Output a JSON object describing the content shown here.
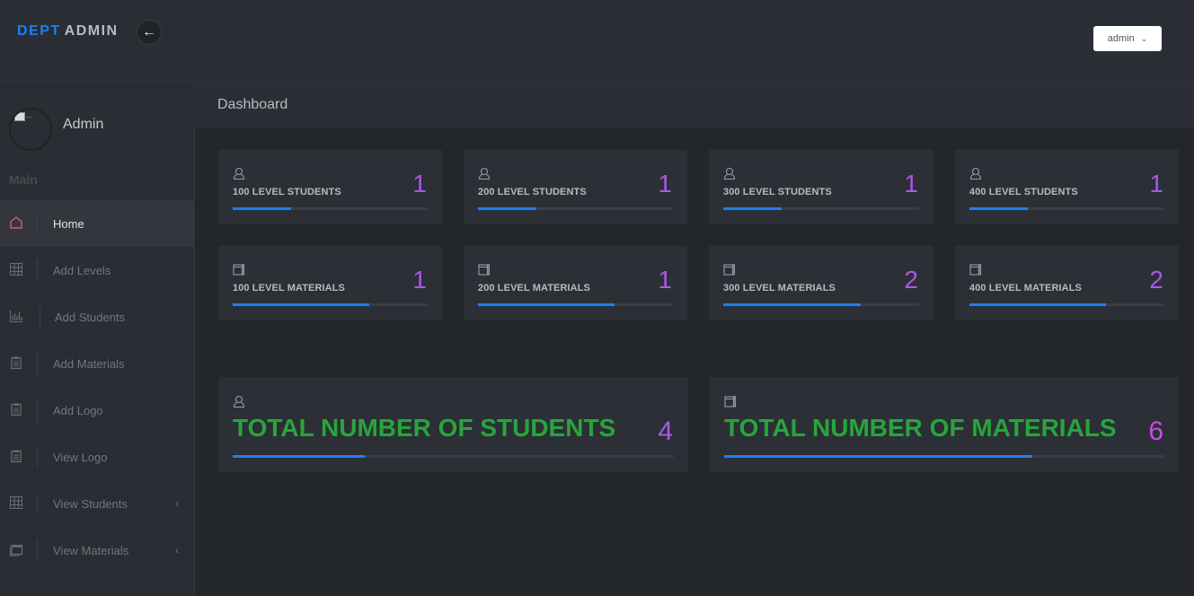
{
  "brand": {
    "part1": "DEPT",
    "part2": "ADMIN"
  },
  "topbar": {
    "back_icon": "arrow-left-icon",
    "user_menu_label": "admin"
  },
  "sidebar": {
    "profile_name": "Admin",
    "profile_image_alt": "...",
    "section_label": "Main",
    "items": [
      {
        "label": "Home",
        "icon": "home-icon",
        "active": true,
        "has_submenu": false
      },
      {
        "label": "Add Levels",
        "icon": "grid-icon",
        "active": false,
        "has_submenu": false
      },
      {
        "label": "Add Students",
        "icon": "bar-chart-icon",
        "active": false,
        "has_submenu": false
      },
      {
        "label": "Add Materials",
        "icon": "clipboard-icon",
        "active": false,
        "has_submenu": false
      },
      {
        "label": "Add Logo",
        "icon": "clipboard-icon",
        "active": false,
        "has_submenu": false
      },
      {
        "label": "View Logo",
        "icon": "clipboard-icon",
        "active": false,
        "has_submenu": false
      },
      {
        "label": "View Students",
        "icon": "grid-icon",
        "active": false,
        "has_submenu": true
      },
      {
        "label": "View Materials",
        "icon": "window-icon",
        "active": false,
        "has_submenu": true
      }
    ]
  },
  "page": {
    "title": "Dashboard"
  },
  "stats": [
    {
      "label": "100 LEVEL STUDENTS",
      "value": "1",
      "icon": "user-icon",
      "progress": 0.3
    },
    {
      "label": "200 LEVEL STUDENTS",
      "value": "1",
      "icon": "user-icon",
      "progress": 0.3
    },
    {
      "label": "300 LEVEL STUDENTS",
      "value": "1",
      "icon": "user-icon",
      "progress": 0.3
    },
    {
      "label": "400 LEVEL STUDENTS",
      "value": "1",
      "icon": "user-icon",
      "progress": 0.3
    },
    {
      "label": "100 LEVEL MATERIALS",
      "value": "1",
      "icon": "book-icon",
      "progress": 0.7
    },
    {
      "label": "200 LEVEL MATERIALS",
      "value": "1",
      "icon": "book-icon",
      "progress": 0.7
    },
    {
      "label": "300 LEVEL MATERIALS",
      "value": "2",
      "icon": "book-icon",
      "progress": 0.7
    },
    {
      "label": "400 LEVEL MATERIALS",
      "value": "2",
      "icon": "book-icon",
      "progress": 0.7
    }
  ],
  "totals": [
    {
      "label": "TOTAL NUMBER OF STUDENTS",
      "value": "4",
      "icon": "user-icon",
      "progress": 0.3
    },
    {
      "label": "TOTAL NUMBER OF MATERIALS",
      "value": "6",
      "icon": "book-icon",
      "progress": 0.7
    }
  ],
  "colors": {
    "accent_blue": "#1e7ff0",
    "number_purple": "#a65ae8",
    "total_green": "#27a53c",
    "home_icon_red": "#e2566b"
  }
}
